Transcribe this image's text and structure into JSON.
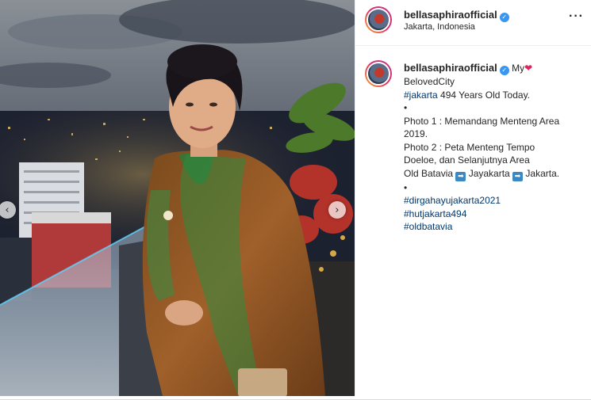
{
  "post": {
    "username": "bellasaphiraofficial",
    "location": "Jakarta, Indonesia",
    "more_icon": "more-horizontal-icon",
    "verified_icon": "verified-badge-icon",
    "nav": {
      "prev_icon": "chevron-left-icon",
      "next_icon": "chevron-right-icon",
      "prev_glyph": "‹",
      "next_glyph": "›"
    }
  },
  "caption": {
    "username": "bellasaphiraofficial",
    "my": "My",
    "heart": "❤",
    "beloved": "BelovedCity",
    "tag_jakarta": "#jakarta",
    "years": " 494 Years Old Today.",
    "bullet1": "•",
    "photo1_a": "Photo 1 : Memandang Menteng Area",
    "photo1_b": "2019.",
    "photo2_a": "Photo 2 : Peta Menteng Tempo",
    "photo2_b": "Doeloe, dan Selanjutnya Area",
    "old_batavia": "Old Batavia ",
    "arrow": "➡",
    "jayakarta": " Jayakarta ",
    "jakarta": " Jakarta.",
    "bullet2": "•",
    "hashtags": [
      "#dirgahayujakarta2021",
      "#hutjakarta494",
      "#oldbatavia"
    ]
  },
  "colors": {
    "link": "#00376b",
    "verified": "#3897f0",
    "heart": "#e0245e"
  }
}
